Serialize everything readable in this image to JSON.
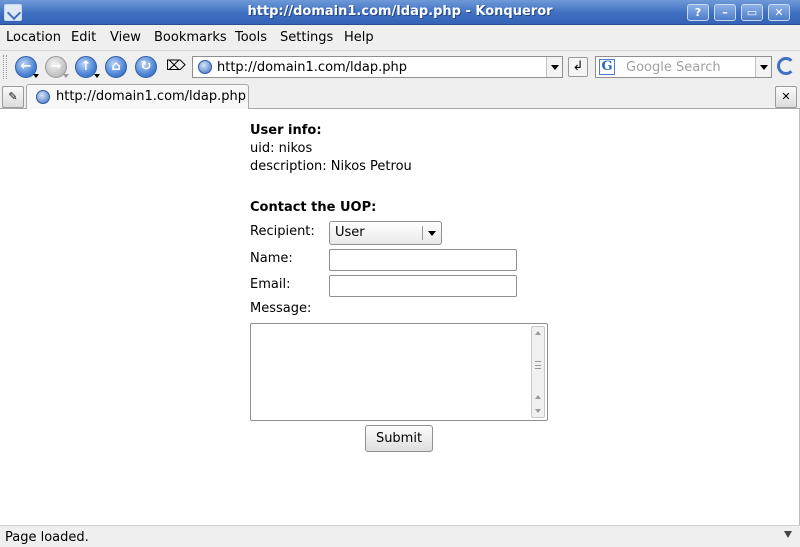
{
  "window": {
    "title": "http://domain1.com/ldap.php - Konqueror",
    "help_btn": "?",
    "minimize_btn": "–",
    "maximize_btn": "▭",
    "close_btn": "✕"
  },
  "menu": {
    "location": "Location",
    "edit": "Edit",
    "view": "View",
    "bookmarks": "Bookmarks",
    "tools": "Tools",
    "settings": "Settings",
    "help": "Help"
  },
  "toolbar": {
    "url": "http://domain1.com/ldap.php",
    "search_placeholder": "Google Search",
    "search_logo": "G"
  },
  "tabs": [
    {
      "label": "http://domain1.com/ldap.php"
    }
  ],
  "page": {
    "user_info_heading": "User info:",
    "uid_line": "uid: nikos",
    "description_line": "description: Nikos Petrou",
    "contact_heading": "Contact the UOP:",
    "recipient_label": "Recipient:",
    "recipient_value": "User",
    "name_label": "Name:",
    "name_value": "",
    "email_label": "Email:",
    "email_value": "",
    "message_label": "Message:",
    "message_value": "",
    "submit_label": "Submit"
  },
  "status": {
    "text": "Page loaded."
  }
}
